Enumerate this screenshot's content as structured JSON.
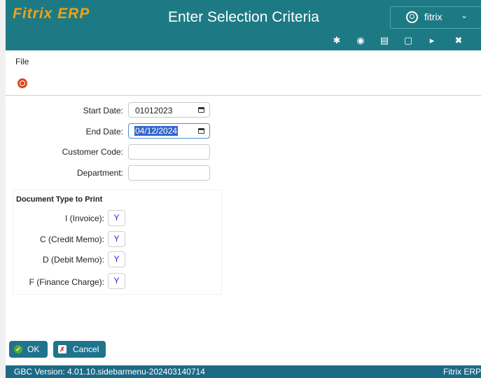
{
  "header": {
    "logo_text": "Fitrix ERP",
    "title": "Enter Selection Criteria",
    "user_name": "fitrix",
    "user_chevron": "⌄",
    "toolbar_icons": [
      "gear-icon",
      "globe-icon",
      "document-icon",
      "new-document-icon",
      "play-icon",
      "close-circle-icon"
    ]
  },
  "menu": {
    "file_label": "File"
  },
  "form": {
    "start_date": {
      "label": "Start Date:",
      "value": "01012023"
    },
    "end_date": {
      "label": "End Date:",
      "value": "04/12/2024"
    },
    "customer_code": {
      "label": "Customer Code:",
      "value": ""
    },
    "department": {
      "label": "Department:",
      "value": ""
    }
  },
  "document_type": {
    "title": "Document Type to Print",
    "items": [
      {
        "label": "I (Invoice):",
        "value": "Y"
      },
      {
        "label": "C (Credit Memo):",
        "value": "Y"
      },
      {
        "label": "D (Debit Memo):",
        "value": "Y"
      },
      {
        "label": "F (Finance Charge):",
        "value": "Y"
      }
    ]
  },
  "actions": {
    "ok_label": "OK",
    "cancel_label": "Cancel"
  },
  "status": {
    "version": "GBC Version: 4.01.10.sidebarmenu-202403140714",
    "brand": "Fitrix ERP"
  },
  "colors": {
    "header_bg": "#1d7a84",
    "logo_accent": "#f2a114",
    "button_bg": "#20738c",
    "status_bg": "#1d6a86",
    "yn_text": "#2a2ad0"
  }
}
